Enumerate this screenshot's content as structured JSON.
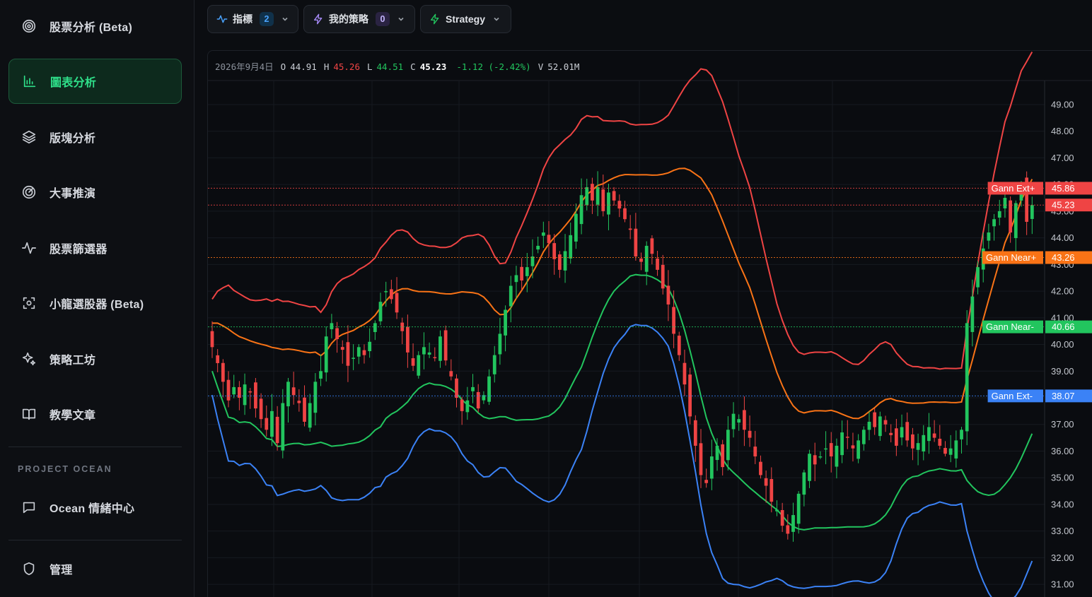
{
  "sidebar": {
    "items": [
      {
        "label": "股票分析 (Beta)",
        "icon": "target-icon",
        "active": false
      },
      {
        "label": "圖表分析",
        "icon": "bar-chart-icon",
        "active": true
      },
      {
        "label": "版塊分析",
        "icon": "layers-icon",
        "active": false
      },
      {
        "label": "大事推演",
        "icon": "radar-icon",
        "active": false
      },
      {
        "label": "股票篩選器",
        "icon": "pulse-icon",
        "active": false
      },
      {
        "label": "小龍選股器 (Beta)",
        "icon": "scan-icon",
        "active": false
      },
      {
        "label": "策略工坊",
        "icon": "sparkles-icon",
        "active": false
      },
      {
        "label": "教學文章",
        "icon": "book-icon",
        "active": false
      }
    ],
    "section_label": "PROJECT OCEAN",
    "ocean_item": {
      "label": "Ocean 情緒中心",
      "icon": "chat-icon"
    },
    "admin_item": {
      "label": "管理",
      "icon": "shield-icon"
    }
  },
  "toolbar": {
    "indicators": {
      "label": "指標",
      "count": "2",
      "icon": "pulse-icon"
    },
    "my_strategy": {
      "label": "我的策略",
      "count": "0",
      "icon": "bolt-icon"
    },
    "strategy": {
      "label": "Strategy",
      "icon": "bolt-icon"
    }
  },
  "ohlc": {
    "date": "2026年9月4日",
    "o_label": "O",
    "o": "44.91",
    "h_label": "H",
    "h": "45.26",
    "l_label": "L",
    "l": "44.51",
    "c_label": "C",
    "c": "45.23",
    "change": "-1.12 (-2.42%)",
    "v_label": "V",
    "v": "52.01M"
  },
  "colors": {
    "up": "#22c55e",
    "down": "#ef4444",
    "orange": "#f97316",
    "blue": "#3b82f6",
    "accent": "#2fe08a"
  },
  "chart_data": {
    "type": "candlestick",
    "y_ticks": [
      "49.00",
      "48.00",
      "47.00",
      "46.00",
      "45.00",
      "44.00",
      "43.00",
      "42.00",
      "41.00",
      "40.00",
      "39.00",
      "38.00",
      "37.00",
      "36.00",
      "35.00",
      "34.00",
      "33.00",
      "32.00",
      "31.00"
    ],
    "y_range": [
      30.5,
      49.9
    ],
    "levels": [
      {
        "label": "Gann Ext+",
        "value": 45.86,
        "value_text": "45.86",
        "color": "#ef4444"
      },
      {
        "label": "",
        "value": 45.23,
        "value_text": "45.23",
        "color": "#ef4444"
      },
      {
        "label": "Gann Near+",
        "value": 43.26,
        "value_text": "43.26",
        "color": "#f97316"
      },
      {
        "label": "Gann Near-",
        "value": 40.66,
        "value_text": "40.66",
        "color": "#22c55e"
      },
      {
        "label": "Gann Ext-",
        "value": 38.07,
        "value_text": "38.07",
        "color": "#3b82f6"
      }
    ],
    "closes": [
      39.9,
      39.3,
      38.6,
      37.9,
      38.4,
      38.0,
      38.5,
      38.2,
      37.6,
      37.2,
      36.8,
      37.5,
      36.3,
      37.8,
      38.6,
      38.1,
      37.8,
      37.1,
      37.8,
      38.6,
      39.0,
      40.3,
      40.8,
      40.2,
      39.8,
      39.2,
      39.5,
      39.9,
      39.6,
      40.1,
      40.8,
      41.6,
      42.0,
      41.7,
      41.2,
      40.5,
      39.7,
      39.2,
      39.6,
      39.9,
      39.7,
      39.5,
      40.3,
      39.4,
      38.8,
      38.0,
      37.5,
      37.9,
      38.4,
      37.6,
      38.1,
      38.8,
      39.6,
      40.4,
      41.3,
      42.2,
      42.6,
      42.4,
      42.9,
      43.3,
      43.7,
      44.2,
      43.8,
      43.2,
      42.8,
      43.5,
      44.1,
      44.9,
      45.6,
      45.9,
      45.4,
      45.9,
      45.0,
      45.7,
      45.4,
      45.1,
      44.7,
      44.3,
      43.3,
      43.1,
      43.7,
      43.4,
      42.8,
      42.1,
      41.5,
      40.4,
      39.6,
      38.5,
      37.3,
      36.2,
      35.1,
      34.8,
      35.8,
      36.2,
      35.4,
      36.8,
      37.4,
      37.2,
      36.8,
      36.5,
      35.8,
      35.1,
      34.7,
      34.1,
      33.8,
      33.2,
      32.9,
      33.6,
      34.4,
      35.2,
      35.9,
      35.5,
      35.8,
      36.1,
      35.8,
      36.2,
      36.7,
      36.5,
      36.1,
      36.4,
      36.8,
      37.1,
      36.9,
      37.3,
      37.0,
      36.6,
      36.2,
      36.9,
      36.4,
      36.1,
      36.3,
      36.6,
      36.9,
      36.5,
      36.2,
      35.9,
      36.1,
      36.4,
      36.8,
      40.8,
      41.8,
      42.9,
      43.6,
      44.2,
      44.7,
      45.0,
      45.5,
      44.2,
      45.3,
      45.9,
      44.6,
      45.23
    ]
  }
}
